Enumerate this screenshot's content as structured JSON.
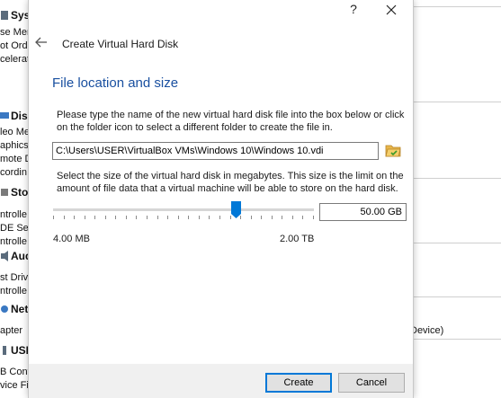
{
  "background": {
    "sections": [
      {
        "title": "Sys",
        "lines": [
          "se Mem",
          "ot Ord",
          "celerat"
        ]
      },
      {
        "title": "Dis",
        "lines": [
          "leo Mem",
          "aphics",
          "mote De",
          "cordin"
        ]
      },
      {
        "title": "Sto",
        "lines": [
          "ntrolle",
          "DE Sec",
          "ntrolle"
        ]
      },
      {
        "title": "Aud",
        "lines": [
          "st Driv",
          "ntrolle"
        ]
      },
      {
        "title": "Net",
        "lines": [
          "apter"
        ]
      },
      {
        "title": "USB",
        "lines": [
          "B Cont",
          "vice Fil"
        ]
      }
    ],
    "right_text": "Device)"
  },
  "dialog": {
    "help_label": "?",
    "wizard_title": "Create Virtual Hard Disk",
    "section_title": "File location and size",
    "location_description": "Please type the name of the new virtual hard disk file into the box below or click on the folder icon to select a different folder to create the file in.",
    "file_path": "C:\\Users\\USER\\VirtualBox VMs\\Windows 10\\Windows 10.vdi",
    "size_description": "Select the size of the virtual hard disk in megabytes. This size is the limit on the amount of file data that a virtual machine will be able to store on the hard disk.",
    "size_value": "50.00 GB",
    "slider_position_fraction": 0.7,
    "min_size_label": "4.00 MB",
    "max_size_label": "2.00 TB",
    "create_label": "Create",
    "cancel_label": "Cancel",
    "accent_color": "#1a50a0",
    "slider_color": "#0078d7"
  }
}
